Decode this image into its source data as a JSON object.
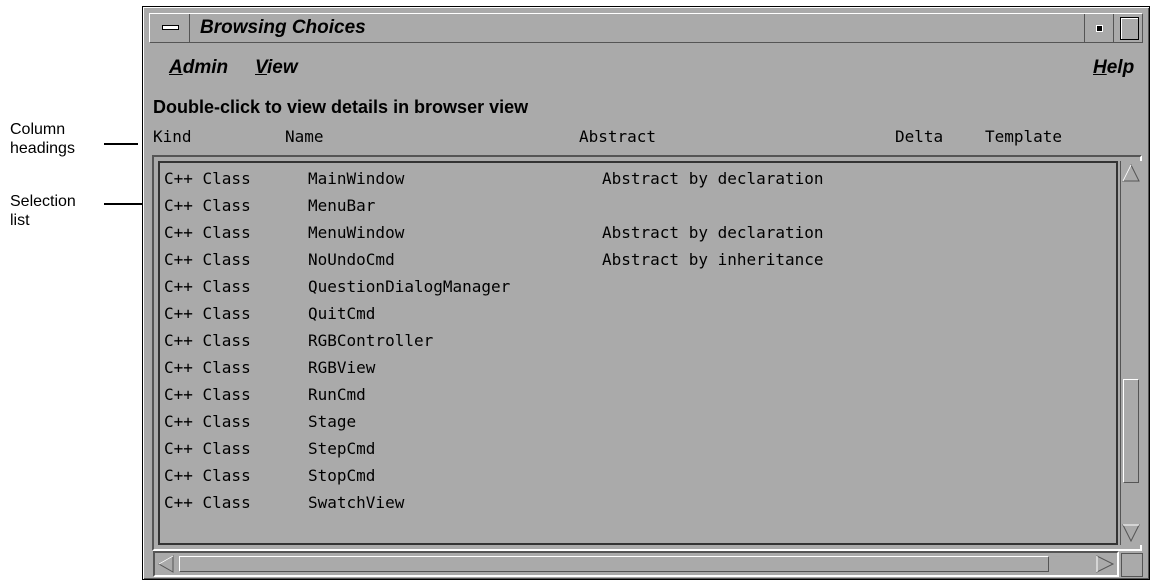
{
  "window": {
    "title": "Browsing Choices"
  },
  "menubar": {
    "admin": "Admin",
    "view": "View",
    "help": "Help",
    "admin_mnemonic": "A",
    "admin_rest": "dmin",
    "view_mnemonic": "V",
    "view_rest": "iew",
    "help_mnemonic": "H",
    "help_rest": "elp"
  },
  "instruction": "Double-click to view details in browser view",
  "columns": {
    "kind": "Kind",
    "name": "Name",
    "abstract": "Abstract",
    "delta": "Delta",
    "template": "Template"
  },
  "rows": [
    {
      "kind": "C++ Class",
      "name": "MainWindow",
      "abstract": "Abstract by declaration"
    },
    {
      "kind": "C++ Class",
      "name": "MenuBar",
      "abstract": ""
    },
    {
      "kind": "C++ Class",
      "name": "MenuWindow",
      "abstract": "Abstract by declaration"
    },
    {
      "kind": "C++ Class",
      "name": "NoUndoCmd",
      "abstract": "Abstract by inheritance"
    },
    {
      "kind": "C++ Class",
      "name": "QuestionDialogManager",
      "abstract": ""
    },
    {
      "kind": "C++ Class",
      "name": "QuitCmd",
      "abstract": ""
    },
    {
      "kind": "C++ Class",
      "name": "RGBController",
      "abstract": ""
    },
    {
      "kind": "C++ Class",
      "name": "RGBView",
      "abstract": ""
    },
    {
      "kind": "C++ Class",
      "name": "RunCmd",
      "abstract": ""
    },
    {
      "kind": "C++ Class",
      "name": "Stage",
      "abstract": ""
    },
    {
      "kind": "C++ Class",
      "name": "StepCmd",
      "abstract": ""
    },
    {
      "kind": "C++ Class",
      "name": "StopCmd",
      "abstract": ""
    },
    {
      "kind": "C++ Class",
      "name": "SwatchView",
      "abstract": ""
    }
  ],
  "callouts": {
    "column_headings_1": "Column",
    "column_headings_2": "headings",
    "selection_list_1": "Selection",
    "selection_list_2": "list"
  },
  "icons": {
    "window_menu": "window-menu-icon",
    "minimize": "minimize-icon",
    "maximize": "maximize-icon",
    "up": "arrow-up-icon",
    "down": "arrow-down-icon",
    "left": "arrow-left-icon",
    "right": "arrow-right-icon"
  },
  "colors": {
    "window_bg": "#aaaaaa",
    "shadow": "#555555",
    "highlight": "#ffffff"
  }
}
